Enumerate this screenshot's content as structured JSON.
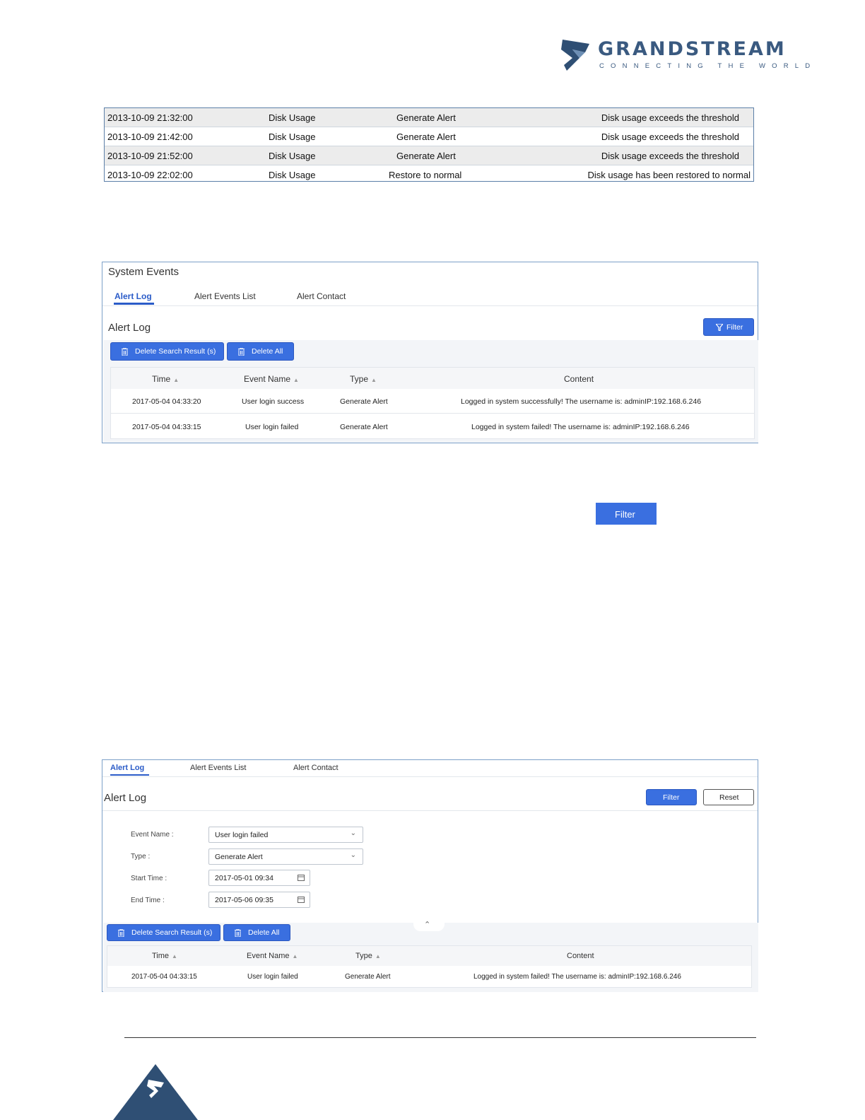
{
  "header": {
    "brand_name": "GRANDSTREAM",
    "tagline": "CONNECTING THE WORLD"
  },
  "disk_table": {
    "rows": [
      {
        "time": "2013-10-09 21:32:00",
        "event": "Disk Usage",
        "type": "Generate Alert",
        "content": "Disk usage exceeds the threshold"
      },
      {
        "time": "2013-10-09 21:42:00",
        "event": "Disk Usage",
        "type": "Generate Alert",
        "content": "Disk usage exceeds the threshold"
      },
      {
        "time": "2013-10-09 21:52:00",
        "event": "Disk Usage",
        "type": "Generate Alert",
        "content": "Disk usage exceeds the threshold"
      },
      {
        "time": "2013-10-09 22:02:00",
        "event": "Disk Usage",
        "type": "Restore to normal",
        "content": "Disk usage has been restored to normal"
      }
    ]
  },
  "system_events": {
    "title": "System Events",
    "tabs": [
      "Alert Log",
      "Alert Events List",
      "Alert Contact"
    ],
    "section_title": "Alert Log",
    "filter_label": "Filter",
    "delete_search_label": "Delete Search Result (s)",
    "delete_all_label": "Delete All",
    "columns": [
      "Time",
      "Event Name",
      "Type",
      "Content"
    ],
    "rows": [
      {
        "time": "2017-05-04 04:33:20",
        "event": "User login success",
        "type": "Generate Alert",
        "content": "Logged in system successfully! The username is: adminIP:192.168.6.246"
      },
      {
        "time": "2017-05-04 04:33:15",
        "event": "User login failed",
        "type": "Generate Alert",
        "content": "Logged in system failed! The username is: adminIP:192.168.6.246"
      }
    ]
  },
  "standalone_filter": {
    "label": "Filter"
  },
  "filtered_view": {
    "tabs": [
      "Alert Log",
      "Alert Events List",
      "Alert Contact"
    ],
    "section_title": "Alert Log",
    "filter_label": "Filter",
    "reset_label": "Reset",
    "fields": {
      "event_name_label": "Event Name :",
      "event_name_value": "User login failed",
      "type_label": "Type :",
      "type_value": "Generate Alert",
      "start_label": "Start Time :",
      "start_value": "2017-05-01 09:34",
      "end_label": "End Time :",
      "end_value": "2017-05-06 09:35"
    },
    "delete_search_label": "Delete Search Result (s)",
    "delete_all_label": "Delete All",
    "columns": [
      "Time",
      "Event Name",
      "Type",
      "Content"
    ],
    "rows": [
      {
        "time": "2017-05-04 04:33:15",
        "event": "User login failed",
        "type": "Generate Alert",
        "content": "Logged in system failed! The username is: adminIP:192.168.6.246"
      }
    ]
  },
  "colors": {
    "accent": "#3a6fe0",
    "brand": "#3a5a80",
    "panel_border": "#7ca0c8"
  }
}
